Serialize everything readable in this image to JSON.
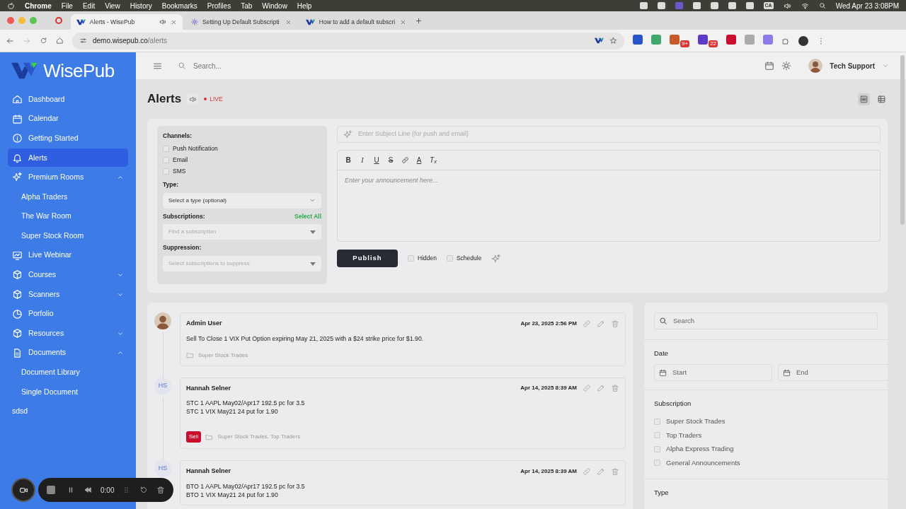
{
  "menubar": {
    "app": "Chrome",
    "menus": [
      "File",
      "Edit",
      "View",
      "History",
      "Bookmarks",
      "Profiles",
      "Tab",
      "Window",
      "Help"
    ],
    "status_text": "CA",
    "clock": "Wed Apr 23  3:08PM"
  },
  "browser_tabs": [
    {
      "title": "Alerts - WisePub",
      "selected": true
    },
    {
      "title": "Setting Up Default Subscripti",
      "selected": false
    },
    {
      "title": "How to add a default subscri",
      "selected": false
    }
  ],
  "address": {
    "host": "demo.wisepub.co",
    "path": "/alerts"
  },
  "extension_badges": [
    "9+",
    "22"
  ],
  "logo": "WisePub",
  "sidebar": {
    "items": [
      {
        "label": "Dashboard",
        "selected": false
      },
      {
        "label": "Calendar",
        "selected": false
      },
      {
        "label": "Getting Started",
        "selected": false
      },
      {
        "label": "Alerts",
        "selected": true
      },
      {
        "label": "Premium Rooms",
        "selected": false,
        "expanded": true,
        "children": [
          {
            "label": "Alpha Traders",
            "selected": false
          },
          {
            "label": "The War Room",
            "selected": false
          },
          {
            "label": "Super Stock Room",
            "selected": false
          }
        ]
      },
      {
        "label": "Live Webinar",
        "selected": false
      },
      {
        "label": "Courses",
        "selected": false,
        "expanded": false
      },
      {
        "label": "Scanners",
        "selected": false,
        "expanded": false
      },
      {
        "label": "Porfolio",
        "selected": false
      },
      {
        "label": "Resources",
        "selected": false,
        "expanded": false
      },
      {
        "label": "Documents",
        "selected": false,
        "expanded": true,
        "children": [
          {
            "label": "Document Library",
            "selected": false
          },
          {
            "label": "Single Document",
            "selected": false
          }
        ]
      },
      {
        "label": "sdsd",
        "selected": false
      }
    ]
  },
  "header": {
    "search_placeholder": "Search...",
    "user": "Tech Support"
  },
  "page": {
    "title": "Alerts",
    "live": "LIVE",
    "view_modes": [
      {
        "kind": "list",
        "selected": true
      },
      {
        "kind": "grid",
        "selected": false
      }
    ]
  },
  "composer": {
    "channels_label": "Channels:",
    "channels": [
      {
        "label": "Push Notification",
        "checked": false
      },
      {
        "label": "Email",
        "checked": false
      },
      {
        "label": "SMS",
        "checked": false
      }
    ],
    "type_label": "Type:",
    "type_value": "Select a type (optional)",
    "subscriptions_label": "Subscriptions:",
    "select_all": "Select All",
    "subscriptions_placeholder": "Find a subscription",
    "suppression_label": "Suppression:",
    "suppression_placeholder": "Select subscriptions to suppress",
    "subject_placeholder": "Enter Subject Line (for push and email)",
    "toolbar": [
      {
        "kind": "bold",
        "glyph": "B"
      },
      {
        "kind": "italic",
        "glyph": "I"
      },
      {
        "kind": "underline",
        "glyph": "U"
      },
      {
        "kind": "strike",
        "glyph": "S"
      },
      {
        "kind": "link"
      },
      {
        "kind": "color",
        "glyph": "A"
      },
      {
        "kind": "clear",
        "glyph": "T$_{x}$"
      }
    ],
    "body_placeholder": "Enter your announcement here...",
    "publish": "Publish",
    "options": [
      {
        "label": "Hidden",
        "checked": false
      },
      {
        "label": "Schedule",
        "checked": false
      }
    ]
  },
  "feed": [
    {
      "author": "Admin User",
      "time": "Apr 23, 2025 2:56 PM",
      "lines": [
        "Sell To Close 1 VIX Put Option expiring May 21, 2025 with a $24 strike price for $1.90."
      ],
      "subscriptions": "Super Stock Trades"
    },
    {
      "author": "Hannah Selner",
      "initials": "HS",
      "time": "Apr 14, 2025 8:39 AM",
      "lines": [
        "STC 1 AAPL May02/Apr17 192.5 pc for 3.5",
        "STC 1 VIX May21 24 put for 1.90"
      ],
      "tag": {
        "label": "Sell",
        "color": "#c8102e"
      },
      "subscriptions": "Super Stock Trades, Top Traders"
    },
    {
      "author": "Hannah Selner",
      "initials": "HS",
      "time": "Apr 14, 2025 8:39 AM",
      "lines": [
        "BTO 1 AAPL May02/Apr17 192.5 pc for 3.5",
        "BTO 1 VIX May21 24 put for 1.90"
      ]
    }
  ],
  "filters": {
    "search_placeholder": "Search",
    "date_label": "Date",
    "start_placeholder": "Start",
    "end_placeholder": "End",
    "subscription_label": "Subscription",
    "subscriptions": [
      {
        "label": "Super Stock Trades",
        "checked": false
      },
      {
        "label": "Top Traders",
        "checked": false
      },
      {
        "label": "Alpha Express Trading",
        "checked": false
      },
      {
        "label": "General Announcements",
        "checked": false
      }
    ],
    "type_label": "Type"
  },
  "recorder": {
    "time": "0:00"
  }
}
